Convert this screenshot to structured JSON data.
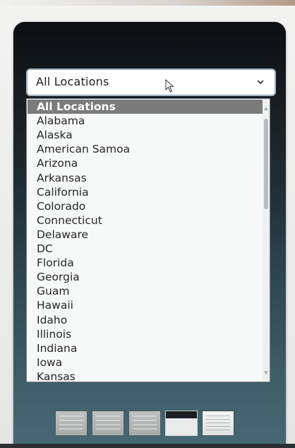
{
  "location_select": {
    "value": "All Locations",
    "chevron_icon": "chevron-down-icon"
  },
  "dropdown": {
    "options": [
      "All Locations",
      "Alabama",
      "Alaska",
      "American Samoa",
      "Arizona",
      "Arkansas",
      "California",
      "Colorado",
      "Connecticut",
      "Delaware",
      "DC",
      "Florida",
      "Georgia",
      "Guam",
      "Hawaii",
      "Idaho",
      "Illinois",
      "Indiana",
      "Iowa",
      "Kansas"
    ],
    "selected_index": 0
  },
  "colors": {
    "panel_top": "#0d0f12",
    "panel_bottom": "#476874",
    "selected_option_bg": "#7b7b7b"
  }
}
